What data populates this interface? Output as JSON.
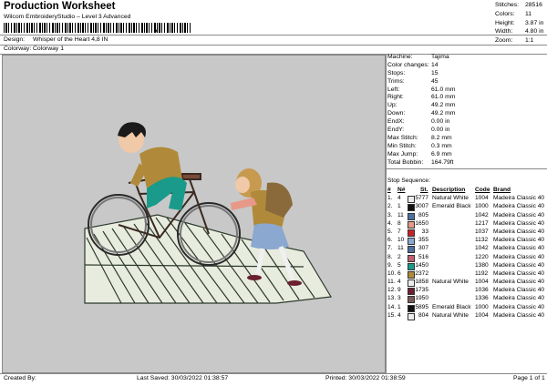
{
  "header": {
    "title": "Production Worksheet",
    "subtitle": "Wilcom EmbroideryStudio – Level 3 Advanced",
    "design_label": "Design:",
    "design_value": "Whisper of the Heart 4,8 IN",
    "colorway_label": "Colorway:",
    "colorway_value": "Colorway 1"
  },
  "stats": [
    {
      "label": "Stitches:",
      "value": "28516"
    },
    {
      "label": "Colors:",
      "value": "11"
    },
    {
      "label": "Height:",
      "value": "3.87 in"
    },
    {
      "label": "Width:",
      "value": "4.80 in"
    },
    {
      "label": "Zoom:",
      "value": "1:1"
    }
  ],
  "machine": [
    {
      "label": "Machine:",
      "value": "Tajima"
    },
    {
      "label": "Color changes:",
      "value": "14"
    },
    {
      "label": "Stops:",
      "value": "15"
    },
    {
      "label": "Trims:",
      "value": "45"
    },
    {
      "label": "Left:",
      "value": "61.0 mm"
    },
    {
      "label": "Right:",
      "value": "61.0 mm"
    },
    {
      "label": "Up:",
      "value": "49.2 mm"
    },
    {
      "label": "Down:",
      "value": "49.2 mm"
    },
    {
      "label": "EndX:",
      "value": "0.00 in"
    },
    {
      "label": "EndY:",
      "value": "0.00 in"
    },
    {
      "label": "Max Stitch:",
      "value": "8.2 mm"
    },
    {
      "label": "Min Stitch:",
      "value": "0.3 mm"
    },
    {
      "label": "Max Jump:",
      "value": "6.9 mm"
    },
    {
      "label": "Total Bobbin:",
      "value": "164.79ft"
    }
  ],
  "stop_sequence": {
    "title": "Stop Sequence:",
    "columns": [
      "#",
      "N#",
      "St.",
      "Description",
      "Code",
      "Brand"
    ],
    "rows": [
      {
        "n": "1.",
        "needle": "4",
        "color": "#ececec",
        "st": "5777",
        "desc": "Natural White",
        "code": "1004",
        "brand": "Madeira Classic 40"
      },
      {
        "n": "2.",
        "needle": "1",
        "color": "#111111",
        "st": "3007",
        "desc": "Emerald Black",
        "code": "1000",
        "brand": "Madeira Classic 40"
      },
      {
        "n": "3.",
        "needle": "11",
        "color": "#4f6fa0",
        "st": "805",
        "desc": "",
        "code": "1042",
        "brand": "Madeira Classic 40"
      },
      {
        "n": "4.",
        "needle": "8",
        "color": "#e89888",
        "st": "1650",
        "desc": "",
        "code": "1217",
        "brand": "Madeira Classic 40"
      },
      {
        "n": "5.",
        "needle": "7",
        "color": "#c8202a",
        "st": "33",
        "desc": "",
        "code": "1037",
        "brand": "Madeira Classic 40"
      },
      {
        "n": "6.",
        "needle": "10",
        "color": "#8aa8d0",
        "st": "355",
        "desc": "",
        "code": "1132",
        "brand": "Madeira Classic 40"
      },
      {
        "n": "7.",
        "needle": "11",
        "color": "#4f6fa0",
        "st": "307",
        "desc": "",
        "code": "1042",
        "brand": "Madeira Classic 40"
      },
      {
        "n": "8.",
        "needle": "2",
        "color": "#c06070",
        "st": "516",
        "desc": "",
        "code": "1220",
        "brand": "Madeira Classic 40"
      },
      {
        "n": "9.",
        "needle": "5",
        "color": "#1a9a8a",
        "st": "1450",
        "desc": "",
        "code": "1380",
        "brand": "Madeira Classic 40"
      },
      {
        "n": "10.",
        "needle": "6",
        "color": "#b08a3a",
        "st": "2372",
        "desc": "",
        "code": "1192",
        "brand": "Madeira Classic 40"
      },
      {
        "n": "11.",
        "needle": "4",
        "color": "#ececec",
        "st": "1858",
        "desc": "Natural White",
        "code": "1004",
        "brand": "Madeira Classic 40"
      },
      {
        "n": "12.",
        "needle": "9",
        "color": "#6a2030",
        "st": "1735",
        "desc": "",
        "code": "1036",
        "brand": "Madeira Classic 40"
      },
      {
        "n": "13.",
        "needle": "3",
        "color": "#7a5a5a",
        "st": "1950",
        "desc": "",
        "code": "1336",
        "brand": "Madeira Classic 40"
      },
      {
        "n": "14.",
        "needle": "1",
        "color": "#111111",
        "st": "5895",
        "desc": "Emerald Black",
        "code": "1000",
        "brand": "Madeira Classic 40"
      },
      {
        "n": "15.",
        "needle": "4",
        "color": "#ececec",
        "st": "804",
        "desc": "Natural White",
        "code": "1004",
        "brand": "Madeira Classic 40"
      }
    ]
  },
  "footer": {
    "created_by": "Created By:",
    "last_saved": "Last Saved: 30/03/2022 01:38:57",
    "printed": "Printed: 30/03/2022 01:38:59",
    "page": "Page 1 of 1"
  },
  "colors": {
    "canvas_bg": "#c8c8c8",
    "border": "#888888"
  }
}
